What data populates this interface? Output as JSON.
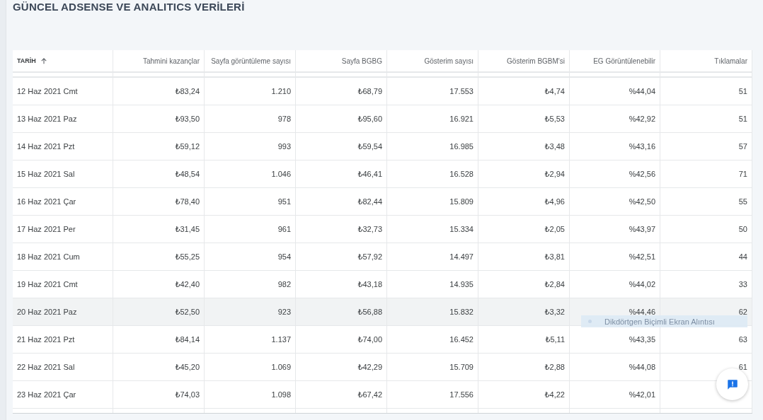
{
  "title": "GÜNCEL ADSENSE VE ANALITICS VERİLERİ",
  "table": {
    "columns": [
      {
        "label": "TARİH",
        "sorted": true
      },
      {
        "label": "Tahmini kazançlar",
        "sorted": false
      },
      {
        "label": "Sayfa görüntüleme sayısı",
        "sorted": false
      },
      {
        "label": "Sayfa BGBG",
        "sorted": false
      },
      {
        "label": "Gösterim sayısı",
        "sorted": false
      },
      {
        "label": "Gösterim BGBM'si",
        "sorted": false
      },
      {
        "label": "EG Görüntülenebilir",
        "sorted": false
      },
      {
        "label": "Tıklamalar",
        "sorted": false
      }
    ],
    "rows": [
      {
        "selected": false,
        "cells": [
          "12 Haz 2021 Cmt",
          "₺83,24",
          "1.210",
          "₺68,79",
          "17.553",
          "₺4,74",
          "%44,04",
          "51"
        ]
      },
      {
        "selected": false,
        "cells": [
          "13 Haz 2021 Paz",
          "₺93,50",
          "978",
          "₺95,60",
          "16.921",
          "₺5,53",
          "%42,92",
          "51"
        ]
      },
      {
        "selected": false,
        "cells": [
          "14 Haz 2021 Pzt",
          "₺59,12",
          "993",
          "₺59,54",
          "16.985",
          "₺3,48",
          "%43,16",
          "57"
        ]
      },
      {
        "selected": false,
        "cells": [
          "15 Haz 2021 Sal",
          "₺48,54",
          "1.046",
          "₺46,41",
          "16.528",
          "₺2,94",
          "%42,56",
          "71"
        ]
      },
      {
        "selected": false,
        "cells": [
          "16 Haz 2021 Çar",
          "₺78,40",
          "951",
          "₺82,44",
          "15.809",
          "₺4,96",
          "%42,50",
          "55"
        ]
      },
      {
        "selected": false,
        "cells": [
          "17 Haz 2021 Per",
          "₺31,45",
          "961",
          "₺32,73",
          "15.334",
          "₺2,05",
          "%43,97",
          "50"
        ]
      },
      {
        "selected": false,
        "cells": [
          "18 Haz 2021 Cum",
          "₺55,25",
          "954",
          "₺57,92",
          "14.497",
          "₺3,81",
          "%42,51",
          "44"
        ]
      },
      {
        "selected": false,
        "cells": [
          "19 Haz 2021 Cmt",
          "₺42,40",
          "982",
          "₺43,18",
          "14.935",
          "₺2,84",
          "%44,02",
          "33"
        ]
      },
      {
        "selected": true,
        "cells": [
          "20 Haz 2021 Paz",
          "₺52,50",
          "923",
          "₺56,88",
          "15.832",
          "₺3,32",
          "%44,46",
          "62"
        ]
      },
      {
        "selected": false,
        "cells": [
          "21 Haz 2021 Pzt",
          "₺84,14",
          "1.137",
          "₺74,00",
          "16.452",
          "₺5,11",
          "%43,35",
          "63"
        ]
      },
      {
        "selected": false,
        "cells": [
          "22 Haz 2021 Sal",
          "₺45,20",
          "1.069",
          "₺42,29",
          "15.709",
          "₺2,88",
          "%44,08",
          "61"
        ]
      },
      {
        "selected": false,
        "cells": [
          "23 Haz 2021 Çar",
          "₺74,03",
          "1.098",
          "₺67,42",
          "17.556",
          "₺4,22",
          "%42,01"
        ]
      }
    ]
  },
  "tooltip": {
    "text": "Dikdörtgen Biçimli Ekran Alıntısı"
  },
  "feedback_button": {
    "kind": "feedback"
  }
}
